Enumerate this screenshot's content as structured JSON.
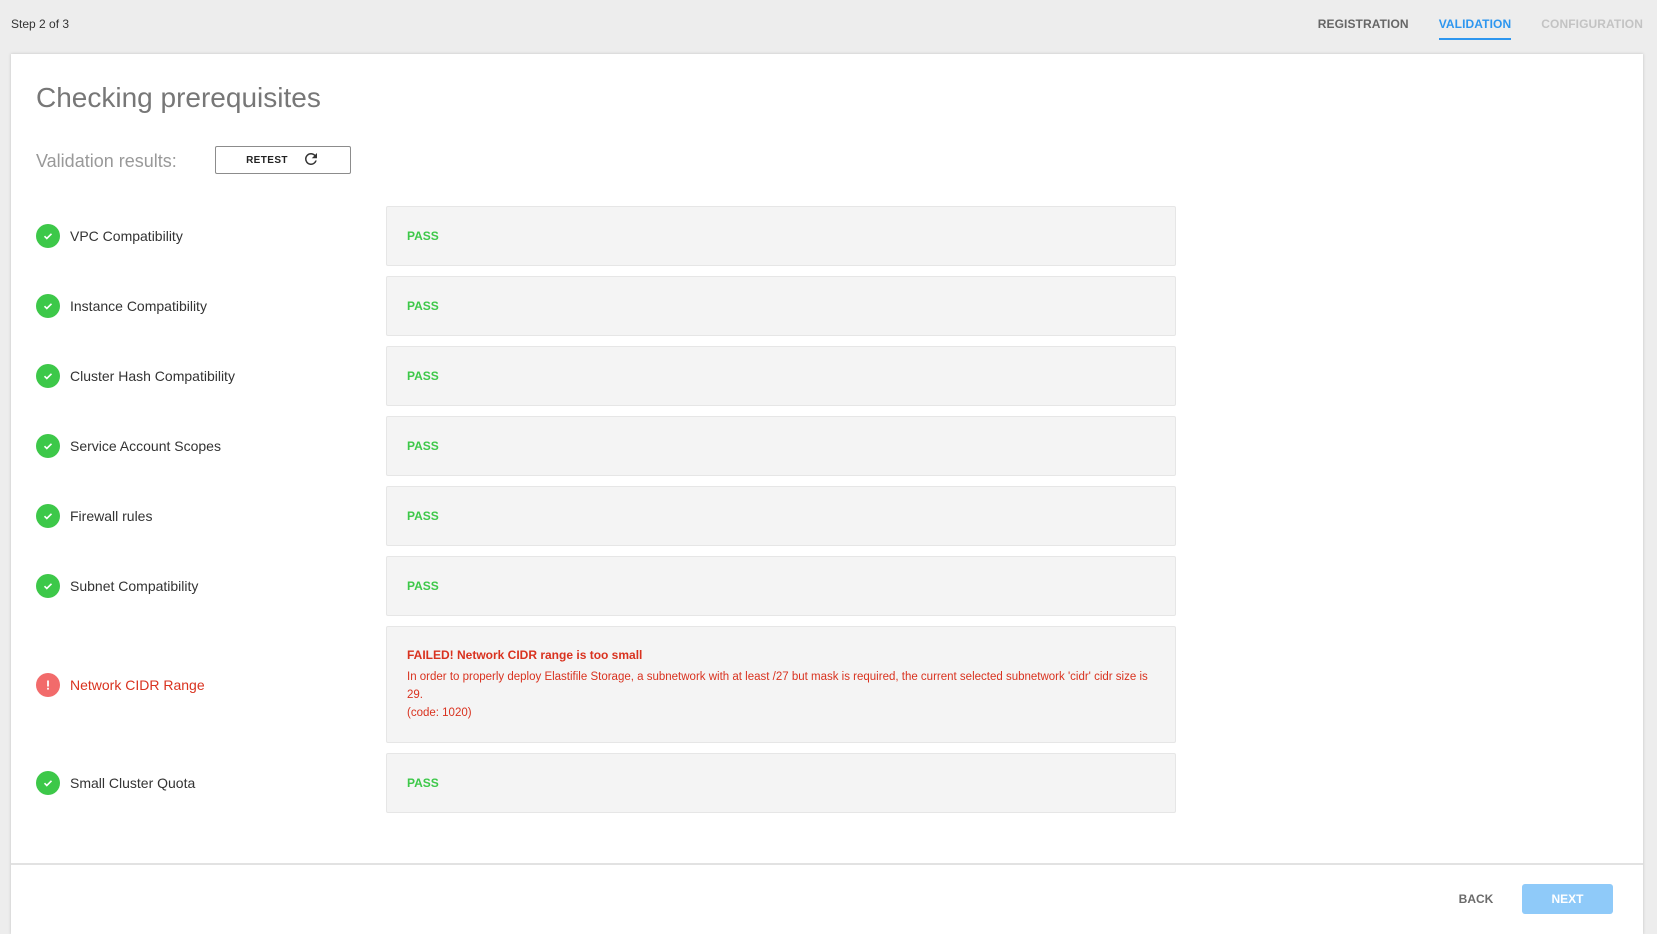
{
  "header": {
    "step_label": "Step 2 of 3",
    "tabs": [
      {
        "label": "REGISTRATION",
        "state": "done"
      },
      {
        "label": "VALIDATION",
        "state": "active"
      },
      {
        "label": "CONFIGURATION",
        "state": "disabled"
      }
    ]
  },
  "page": {
    "title": "Checking prerequisites",
    "validation_label": "Validation results:",
    "retest_label": "RETEST"
  },
  "checks": [
    {
      "name": "VPC Compatibility",
      "status": "pass",
      "result": "PASS"
    },
    {
      "name": "Instance Compatibility",
      "status": "pass",
      "result": "PASS"
    },
    {
      "name": "Cluster Hash Compatibility",
      "status": "pass",
      "result": "PASS"
    },
    {
      "name": "Service Account Scopes",
      "status": "pass",
      "result": "PASS"
    },
    {
      "name": "Firewall rules",
      "status": "pass",
      "result": "PASS"
    },
    {
      "name": "Subnet Compatibility",
      "status": "pass",
      "result": "PASS"
    },
    {
      "name": "Network CIDR Range",
      "status": "fail",
      "result": "FAILED!  Network CIDR range is too small",
      "message": "In order to properly deploy Elastifile Storage, a subnetwork with at least /27 but mask is required, the current selected subnetwork 'cidr' cidr size is 29.",
      "code": "(code: 1020)"
    },
    {
      "name": "Small Cluster Quota",
      "status": "pass",
      "result": "PASS"
    }
  ],
  "footer": {
    "back_label": "BACK",
    "next_label": "NEXT"
  },
  "colors": {
    "accent": "#2d96ef",
    "pass": "#3dc849",
    "fail": "#d9321f",
    "fail_icon": "#f26b6b",
    "next_disabled": "#8fcaf9"
  }
}
